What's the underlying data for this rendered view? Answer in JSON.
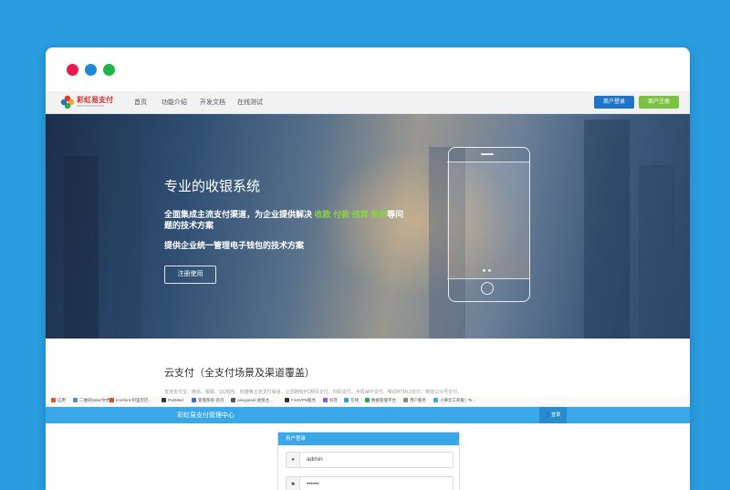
{
  "colors": {
    "page_background": "#2a9ce0",
    "primary_blue": "#1f74c9",
    "register_green": "#7cc242",
    "highlight_green": "#8bd14a",
    "admin_bar_blue": "#3aa8e8"
  },
  "window_controls": [
    "close-dot-red",
    "minimize-dot-blue",
    "maximize-dot-green"
  ],
  "navbar": {
    "logo_text": "彩虹易支付",
    "logo_subtext": "www.xxxxxxxx.com",
    "items": [
      "首页",
      "功能介绍",
      "开发文档",
      "在线测试"
    ],
    "login_button": "商户登录",
    "register_button": "商户注册"
  },
  "hero": {
    "title": "专业的收银系统",
    "line1_prefix": "全面集成主流支付渠道，为企业提供解决",
    "highlights": [
      "收款",
      "付款",
      "结算",
      "营销"
    ],
    "line1_suffix": "等问题的技术方案",
    "line2": "提供企业统一管理电子钱包的技术方案",
    "cta_button": "注册使用"
  },
  "section": {
    "title": "云支付（全支付场景及渠道覆盖）",
    "description": "支持支付宝、微信、银联、QQ钱包、快捷等主流支付渠道，让您拥有PC网页支付、扫码支付、手机APP支付、移动HTML5支付、微信公众号支付。"
  },
  "bookmarks": [
    {
      "label": "应用",
      "icon": "apps-icon",
      "color": "#e0532f"
    },
    {
      "label": "二维码babel文档",
      "icon": "doc-icon",
      "color": "#4a90d9"
    },
    {
      "label": "Iconfont-阿里巴巴...",
      "icon": "iconfont-icon",
      "color": "#e2482a"
    },
    {
      "label": "PubMed",
      "icon": "pubmed-icon",
      "color": "#333333"
    },
    {
      "label": "管理系统-首页",
      "icon": "admin-icon",
      "color": "#3a6fd8"
    },
    {
      "label": "easypanel 虚拟主...",
      "icon": "panel-icon",
      "color": "#555555"
    },
    {
      "label": "FirstVPN服务",
      "icon": "vpn-icon",
      "color": "#333333"
    },
    {
      "label": "抖音",
      "icon": "douyin-icon",
      "color": "#8a5cd1"
    },
    {
      "label": "在线",
      "icon": "online-icon",
      "color": "#3a9ad9"
    },
    {
      "label": "数据管理平台",
      "icon": "data-icon",
      "color": "#2aa84a"
    },
    {
      "label": "用户服务",
      "icon": "user-service-icon",
      "color": "#888888"
    },
    {
      "label": "小微云工商服 | Te...",
      "icon": "cloud-icon",
      "color": "#3aa8e8"
    }
  ],
  "admin": {
    "title": "彩虹易支付管理中心",
    "login_button": "登录",
    "panel_title": "用户登录",
    "username_value": "admin",
    "password_value": "••••••"
  }
}
